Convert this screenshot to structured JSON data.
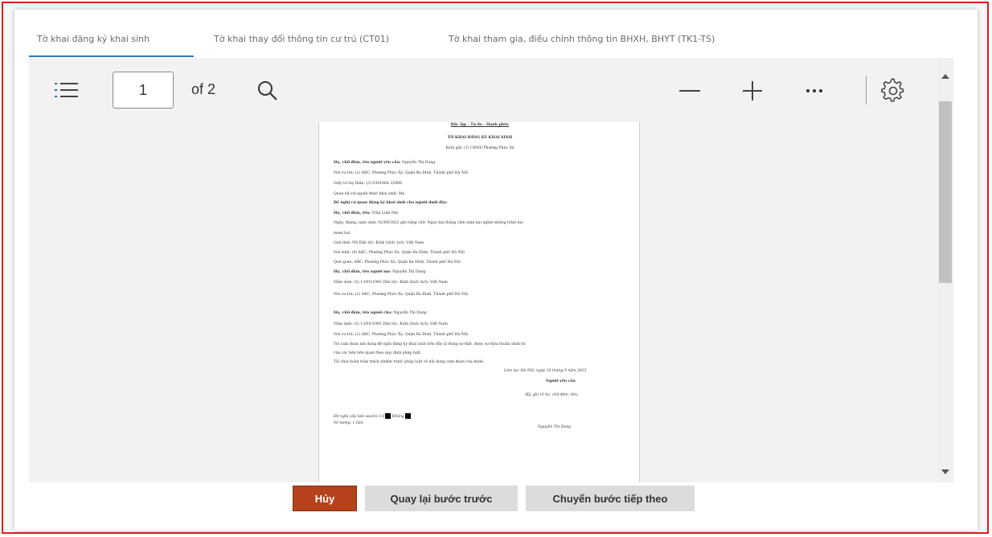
{
  "tabs": [
    {
      "label": "Tờ khai đăng ký khai sinh",
      "active": true
    },
    {
      "label": "Tờ khai thay đổi thông tin cư trú (CT01)",
      "active": false
    },
    {
      "label": "Tờ khai tham gia, điều chỉnh thông tin BHXH, BHYT (TK1-TS)",
      "active": false
    }
  ],
  "toolbar": {
    "page_number": "1",
    "page_total": "of 2",
    "icons": [
      "list-icon",
      "search-icon",
      "zoom-out-icon",
      "zoom-in-icon",
      "more-icon",
      "settings-icon"
    ]
  },
  "document": {
    "motto": "Độc lập - Tự do - Hạnh phúc",
    "title": "TỜ KHAI ĐĂNG KÝ KHAI SINH",
    "to": "Kính gửi: (1) UBND Phường Phúc Xá",
    "requester_name_label": "Họ, chữ đệm, tên người yêu cầu:",
    "requester_name": "Nguyễn Thị Dung",
    "residence": "Nơi cư trú: (2) ABC, Phường Phúc Xá, Quận Ba Đình, Thành phố Hà Nội",
    "id_doc": "Giấy tờ tùy thân: (3) 0301868 32968",
    "relation": "Quan hệ với người được khai sinh: Mẹ",
    "request": "Đề nghị cơ quan đăng ký khai sinh cho người dưới đây:",
    "child_name_label": "Họ, chữ đệm, tên:",
    "child_name": "Trần Linh Nhi",
    "dob": "Ngày, tháng, năm sinh: 02/09/2022 ghi bằng chữ: Ngày hai tháng chín năm hai nghìn không trăm hai",
    "dob_cont": "mươi hai",
    "gender": "Giới tính: Nữ     Dân tộc: Kinh     Quốc tịch: Việt Nam",
    "birthplace": "Nơi sinh: (4) ABC, Phường Phúc Xá, Quận Ba Đình, Thành phố Hà Nội",
    "hometown": "Quê quán: ABC, Phường Phúc Xá, Quận Ba Đình, Thành phố Hà Nội",
    "mother_name_label": "Họ, chữ đệm, tên người mẹ:",
    "mother_name": "Nguyễn Thị Dung",
    "mother_dob": "Năm sinh: (5) 13/05/1985     Dân tộc: Kinh     Quốc tịch: Việt Nam",
    "mother_residence": "Nơi cư trú: (2) ABC, Phường Phúc Xá, Quận Ba Đình, Thành phố Hà Nội",
    "father_name_label": "Họ, chữ đệm, tên người cha:",
    "father_name": "Nguyễn Thị Dung",
    "father_dob": "Năm sinh: (5) 13/05/1985     Dân tộc: Kinh     Quốc tịch: Việt Nam",
    "father_residence": "Nơi cư trú: (2) ABC, Phường Phúc Xá, Quận Ba Đình, Thành phố Hà Nội",
    "commit_1": "Tôi cam đoan nội dung đề nghị đăng ký khai sinh trên đây là đúng sự thật, được sự thỏa thuận nhất trí",
    "commit_2": "của các bên liên quan theo quy định pháp luật.",
    "commit_3": "Tôi chịu hoàn toàn trách nhiệm trước pháp luật về nội dung cam đoan của mình.",
    "place_date": "Làm tại: Hà Nội, ngày 16 tháng 9 năm 2022",
    "signer_title": "Người yêu cầu",
    "signer_note": "(Ký, ghi rõ họ, chữ đệm, tên)",
    "copy_request": "Đề nghị cấp bản sao(6): Có",
    "copy_no": "Không",
    "copy_count": "Số lượng: 1 bản",
    "signature_name": "Nguyễn Thị Dung"
  },
  "buttons": {
    "cancel": "Hủy",
    "back": "Quay lại bước trước",
    "next": "Chuyển bước tiếp theo"
  },
  "colors": {
    "frame_border": "#e21c1c",
    "tab_active_underline": "#2a7ac0",
    "cancel_bg": "#b5421b",
    "secondary_bg": "#dcdcdc"
  }
}
